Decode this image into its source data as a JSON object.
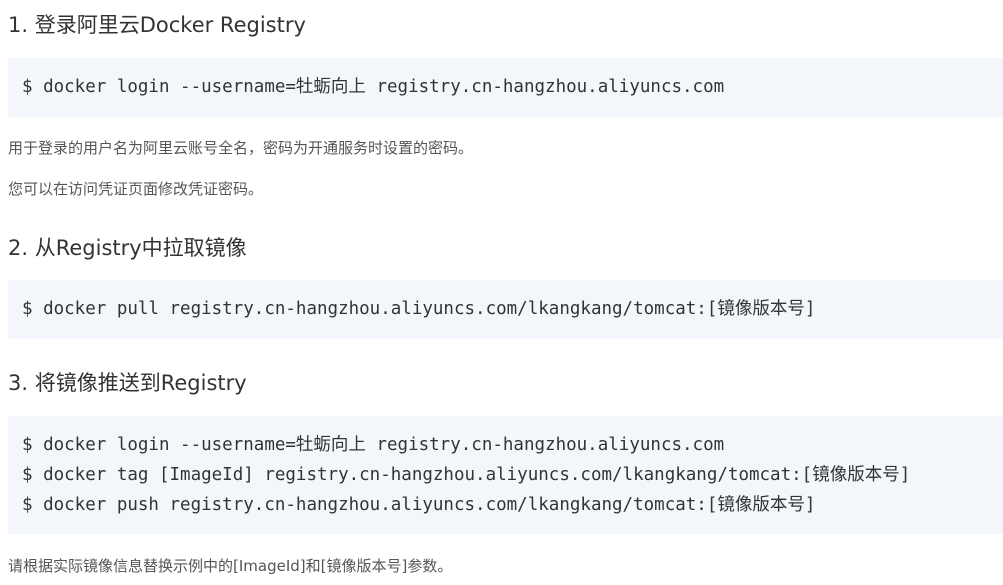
{
  "sections": [
    {
      "title": "1. 登录阿里云Docker Registry",
      "code": [
        "$ docker login --username=牡蛎向上 registry.cn-hangzhou.aliyuncs.com"
      ],
      "notes": [
        "用于登录的用户名为阿里云账号全名，密码为开通服务时设置的密码。",
        "您可以在访问凭证页面修改凭证密码。"
      ]
    },
    {
      "title": "2. 从Registry中拉取镜像",
      "code": [
        "$ docker pull registry.cn-hangzhou.aliyuncs.com/lkangkang/tomcat:[镜像版本号]"
      ]
    },
    {
      "title": "3. 将镜像推送到Registry",
      "code": [
        "$ docker login --username=牡蛎向上 registry.cn-hangzhou.aliyuncs.com",
        "$ docker tag [ImageId] registry.cn-hangzhou.aliyuncs.com/lkangkang/tomcat:[镜像版本号]",
        "$ docker push registry.cn-hangzhou.aliyuncs.com/lkangkang/tomcat:[镜像版本号]"
      ],
      "notes": [
        "请根据实际镜像信息替换示例中的[ImageId]和[镜像版本号]参数。"
      ]
    }
  ]
}
